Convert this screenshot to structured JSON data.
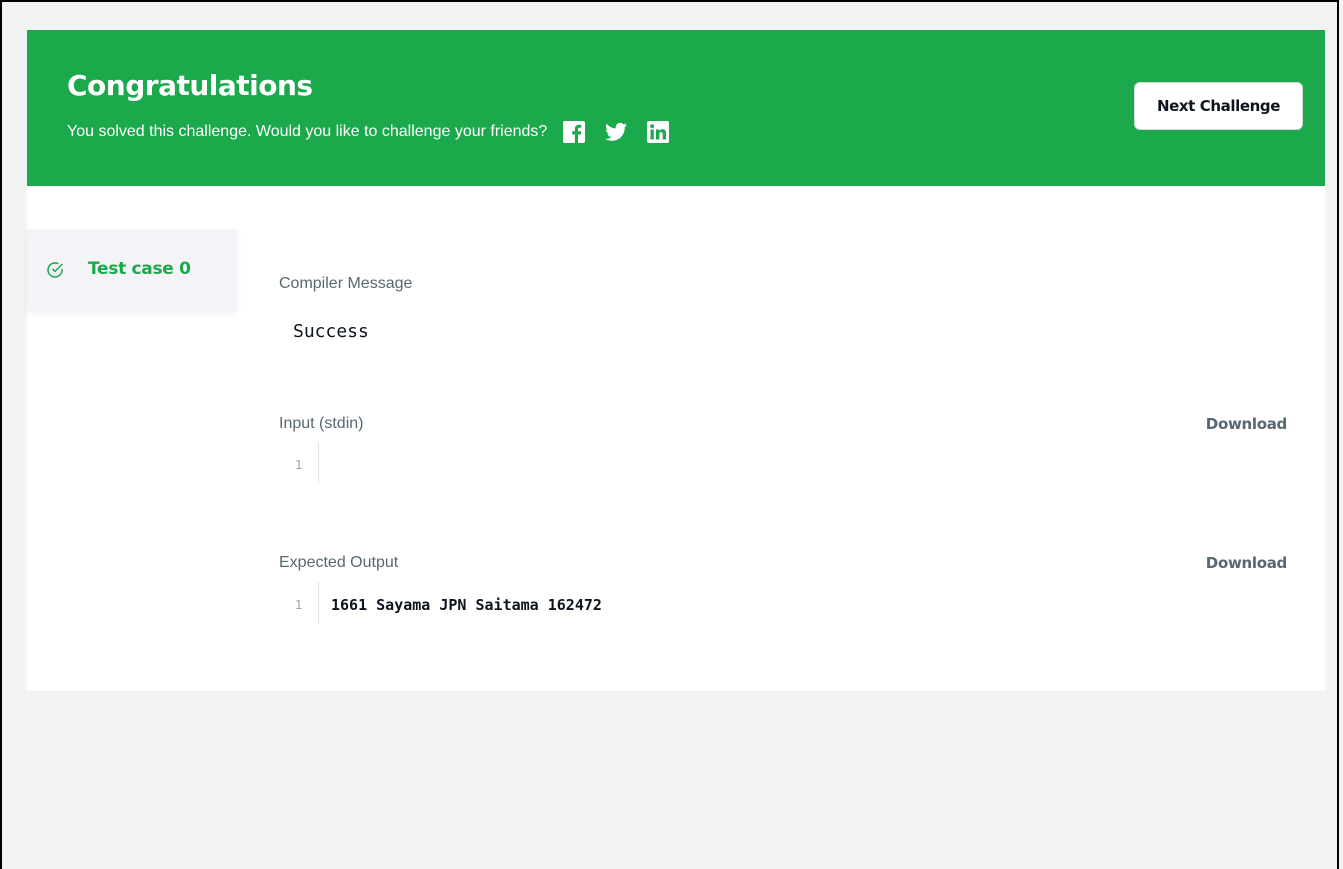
{
  "banner": {
    "title": "Congratulations",
    "subtitle": "You solved this challenge. Would you like to challenge your friends?",
    "social_icons": [
      "facebook-icon",
      "twitter-icon",
      "linkedin-icon"
    ],
    "next_button_label": "Next Challenge",
    "accent_color": "#1ba94c"
  },
  "sidebar": {
    "tabs": [
      {
        "label": "Test case 0",
        "status": "passed",
        "icon": "check-circle-icon"
      }
    ]
  },
  "results": {
    "compiler_message": {
      "label": "Compiler Message",
      "value": "Success"
    },
    "input": {
      "label": "Input (stdin)",
      "download_label": "Download",
      "lines": [
        {
          "number": "1",
          "text": ""
        }
      ]
    },
    "expected_output": {
      "label": "Expected Output",
      "download_label": "Download",
      "lines": [
        {
          "number": "1",
          "text": "1661 Sayama JPN Saitama 162472"
        }
      ]
    }
  }
}
